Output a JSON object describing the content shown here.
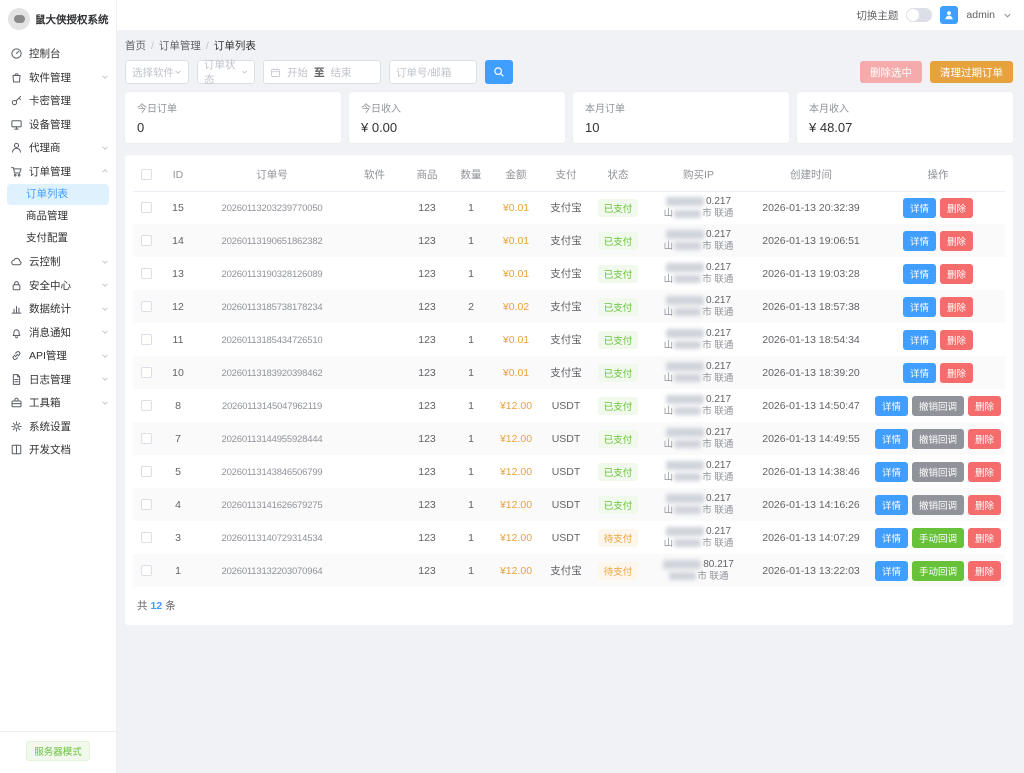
{
  "app": {
    "title": "鼠大侠授权系统"
  },
  "topbar": {
    "theme_label": "切换主题",
    "username": "admin"
  },
  "sidebar": {
    "items": [
      {
        "label": "控制台",
        "icon": "dashboard-icon"
      },
      {
        "label": "软件管理",
        "icon": "software-icon",
        "expandable": true
      },
      {
        "label": "卡密管理",
        "icon": "key-icon"
      },
      {
        "label": "设备管理",
        "icon": "device-icon"
      },
      {
        "label": "代理商",
        "icon": "agent-icon",
        "expandable": true
      },
      {
        "label": "订单管理",
        "icon": "order-icon",
        "expandable": true,
        "expanded": true,
        "children": [
          {
            "label": "订单列表",
            "active": true
          },
          {
            "label": "商品管理"
          },
          {
            "label": "支付配置"
          }
        ]
      },
      {
        "label": "云控制",
        "icon": "cloud-icon",
        "expandable": true
      },
      {
        "label": "安全中心",
        "icon": "security-icon",
        "expandable": true
      },
      {
        "label": "数据统计",
        "icon": "stats-icon",
        "expandable": true
      },
      {
        "label": "消息通知",
        "icon": "notify-icon",
        "expandable": true
      },
      {
        "label": "API管理",
        "icon": "api-icon",
        "expandable": true
      },
      {
        "label": "日志管理",
        "icon": "log-icon",
        "expandable": true
      },
      {
        "label": "工具箱",
        "icon": "toolbox-icon",
        "expandable": true
      },
      {
        "label": "系统设置",
        "icon": "settings-icon"
      },
      {
        "label": "开发文档",
        "icon": "docs-icon"
      }
    ],
    "footer_badge": "服务器模式"
  },
  "breadcrumb": [
    "首页",
    "订单管理",
    "订单列表"
  ],
  "filters": {
    "software_placeholder": "选择软件",
    "status_placeholder": "订单状态",
    "date_start_placeholder": "开始",
    "date_separator": "至",
    "date_end_placeholder": "结束",
    "search_placeholder": "订单号/邮箱",
    "delete_selected_label": "删除选中",
    "clean_expired_label": "清理过期订单"
  },
  "stats": [
    {
      "label": "今日订单",
      "value": "0"
    },
    {
      "label": "今日收入",
      "value": "¥ 0.00"
    },
    {
      "label": "本月订单",
      "value": "10"
    },
    {
      "label": "本月收入",
      "value": "¥ 48.07"
    }
  ],
  "labels": {
    "detail": "详情",
    "delete": "删除",
    "revoke": "撤销回调",
    "manual": "手动回调",
    "paid": "已支付",
    "unpaid": "待支付"
  },
  "table": {
    "columns": [
      "ID",
      "订单号",
      "软件",
      "商品",
      "数量",
      "金额",
      "支付",
      "状态",
      "购买IP",
      "创建时间",
      "操作"
    ],
    "rows": [
      {
        "id": "15",
        "order_no": "20260113203239770050",
        "software": "",
        "product": "123",
        "qty": "1",
        "amount": "¥0.01",
        "pay": "支付宝",
        "status": "paid",
        "ip_tail": "0.217",
        "loc_left": "山",
        "loc_right": "市 联通",
        "created": "2026-01-13 20:32:39",
        "actions": [
          "detail",
          "delete"
        ]
      },
      {
        "id": "14",
        "order_no": "20260113190651862382",
        "software": "",
        "product": "123",
        "qty": "1",
        "amount": "¥0.01",
        "pay": "支付宝",
        "status": "paid",
        "ip_tail": "0.217",
        "loc_left": "山",
        "loc_right": "市 联通",
        "created": "2026-01-13 19:06:51",
        "actions": [
          "detail",
          "delete"
        ]
      },
      {
        "id": "13",
        "order_no": "20260113190328126089",
        "software": "",
        "product": "123",
        "qty": "1",
        "amount": "¥0.01",
        "pay": "支付宝",
        "status": "paid",
        "ip_tail": "0.217",
        "loc_left": "山",
        "loc_right": "市 联通",
        "created": "2026-01-13 19:03:28",
        "actions": [
          "detail",
          "delete"
        ]
      },
      {
        "id": "12",
        "order_no": "20260113185738178234",
        "software": "",
        "product": "123",
        "qty": "2",
        "amount": "¥0.02",
        "pay": "支付宝",
        "status": "paid",
        "ip_tail": "0.217",
        "loc_left": "山",
        "loc_right": "市 联通",
        "created": "2026-01-13 18:57:38",
        "actions": [
          "detail",
          "delete"
        ]
      },
      {
        "id": "11",
        "order_no": "20260113185434726510",
        "software": "",
        "product": "123",
        "qty": "1",
        "amount": "¥0.01",
        "pay": "支付宝",
        "status": "paid",
        "ip_tail": "0.217",
        "loc_left": "山",
        "loc_right": "市 联通",
        "created": "2026-01-13 18:54:34",
        "actions": [
          "detail",
          "delete"
        ]
      },
      {
        "id": "10",
        "order_no": "20260113183920398462",
        "software": "",
        "product": "123",
        "qty": "1",
        "amount": "¥0.01",
        "pay": "支付宝",
        "status": "paid",
        "ip_tail": "0.217",
        "loc_left": "山",
        "loc_right": "市 联通",
        "created": "2026-01-13 18:39:20",
        "actions": [
          "detail",
          "delete"
        ]
      },
      {
        "id": "8",
        "order_no": "20260113145047962119",
        "software": "",
        "product": "123",
        "qty": "1",
        "amount": "¥12.00",
        "pay": "USDT",
        "status": "paid",
        "ip_tail": "0.217",
        "loc_left": "山",
        "loc_right": "市 联通",
        "created": "2026-01-13 14:50:47",
        "actions": [
          "detail",
          "revoke",
          "delete"
        ]
      },
      {
        "id": "7",
        "order_no": "20260113144955928444",
        "software": "",
        "product": "123",
        "qty": "1",
        "amount": "¥12.00",
        "pay": "USDT",
        "status": "paid",
        "ip_tail": "0.217",
        "loc_left": "山",
        "loc_right": "市 联通",
        "created": "2026-01-13 14:49:55",
        "actions": [
          "detail",
          "revoke",
          "delete"
        ]
      },
      {
        "id": "5",
        "order_no": "20260113143846506799",
        "software": "",
        "product": "123",
        "qty": "1",
        "amount": "¥12.00",
        "pay": "USDT",
        "status": "paid",
        "ip_tail": "0.217",
        "loc_left": "山",
        "loc_right": "市 联通",
        "created": "2026-01-13 14:38:46",
        "actions": [
          "detail",
          "revoke",
          "delete"
        ]
      },
      {
        "id": "4",
        "order_no": "20260113141626679275",
        "software": "",
        "product": "123",
        "qty": "1",
        "amount": "¥12.00",
        "pay": "USDT",
        "status": "paid",
        "ip_tail": "0.217",
        "loc_left": "山",
        "loc_right": "市 联通",
        "created": "2026-01-13 14:16:26",
        "actions": [
          "detail",
          "revoke",
          "delete"
        ]
      },
      {
        "id": "3",
        "order_no": "20260113140729314534",
        "software": "",
        "product": "123",
        "qty": "1",
        "amount": "¥12.00",
        "pay": "USDT",
        "status": "unpaid",
        "ip_tail": "0.217",
        "loc_left": "山",
        "loc_right": "市 联通",
        "created": "2026-01-13 14:07:29",
        "actions": [
          "detail",
          "manual",
          "delete"
        ]
      },
      {
        "id": "1",
        "order_no": "20260113132203070964",
        "software": "",
        "product": "123",
        "qty": "1",
        "amount": "¥12.00",
        "pay": "支付宝",
        "status": "unpaid",
        "ip_tail": "80.217",
        "loc_left": "",
        "loc_right": "市 联通",
        "created": "2026-01-13 13:22:03",
        "actions": [
          "detail",
          "manual",
          "delete"
        ]
      }
    ],
    "footer": {
      "total_prefix": "共",
      "total_count": "12",
      "total_suffix": "条"
    }
  },
  "colors": {
    "primary": "#409eff",
    "danger": "#f56c6c",
    "danger_disabled": "#f5abab",
    "warning": "#e6a23c",
    "success": "#67c23a",
    "info": "#909399",
    "paid_bg": "#f0f9eb",
    "unpaid_bg": "#fdf6ec",
    "active_menu_bg": "#dff1fd",
    "page_bg": "#f0f2f5"
  }
}
